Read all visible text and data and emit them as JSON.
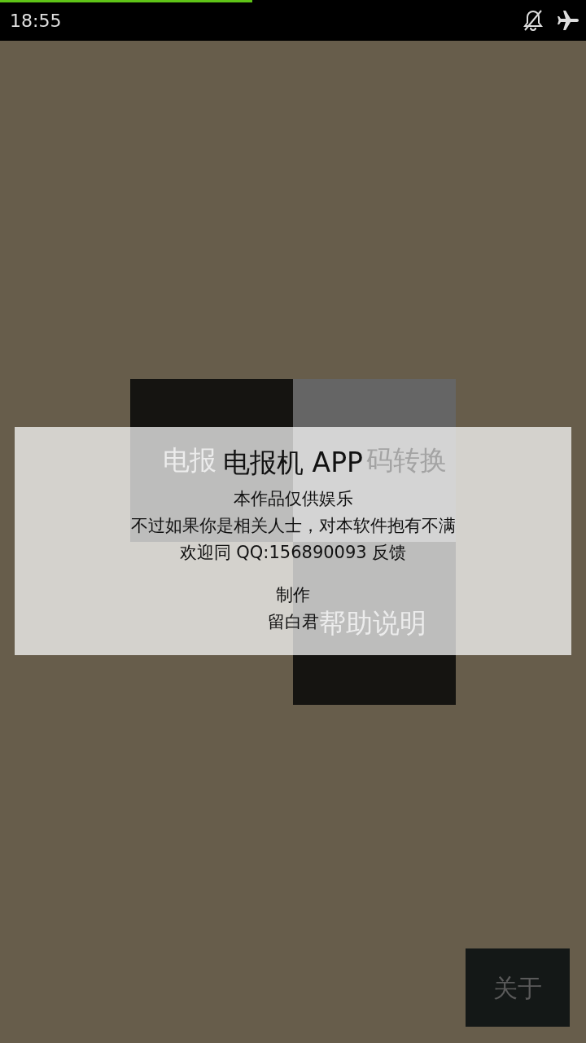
{
  "status_bar": {
    "time": "18:55",
    "progress": {
      "level": 0.43
    }
  },
  "tiles": [
    {
      "label": "电报",
      "color": "#151411"
    },
    {
      "label": "码转换",
      "color": "#656565"
    },
    {
      "label": "帮助说明",
      "color": "#151411"
    }
  ],
  "dialog": {
    "title": "电报机 APP",
    "lines": [
      "本作品仅供娱乐",
      "不过如果你是相关人士，对本软件抱有不满",
      "欢迎同 QQ:156890093 反馈"
    ],
    "credit_label": "制作",
    "author": "留白君"
  },
  "about_button": {
    "label": "关于"
  }
}
